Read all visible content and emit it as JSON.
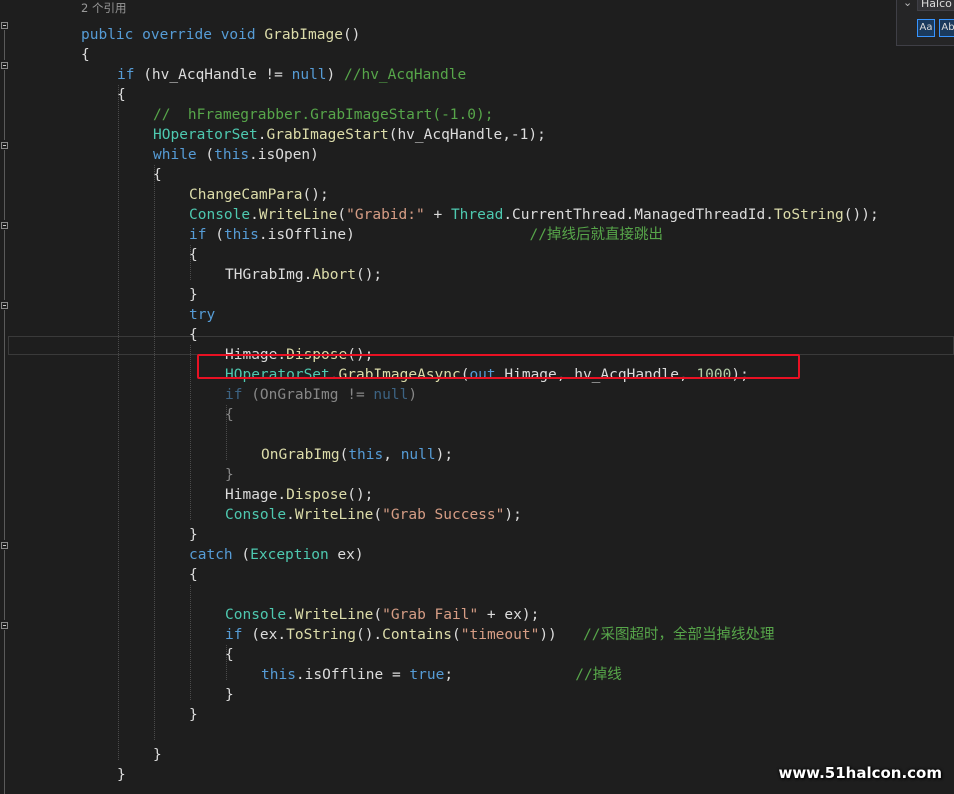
{
  "editor": {
    "colors": {
      "background": "#1e1e1e",
      "keyword": "#569cd6",
      "type": "#4ec9b0",
      "method": "#dcdcaa",
      "string": "#d69d85",
      "comment": "#57a64a",
      "number": "#b5cea8",
      "text": "#dcdcdc",
      "highlight_border": "#e81123"
    },
    "lines": [
      {
        "indent": 0,
        "kind": "codelens",
        "tokens": [
          {
            "t": "2 个引用",
            "c": "lens"
          }
        ]
      },
      {
        "indent": 0,
        "tokens": [
          {
            "t": "public",
            "c": "kw"
          },
          {
            "t": " "
          },
          {
            "t": "override",
            "c": "kw"
          },
          {
            "t": " "
          },
          {
            "t": "void",
            "c": "kw"
          },
          {
            "t": " "
          },
          {
            "t": "GrabImage",
            "c": "fn"
          },
          {
            "t": "()"
          }
        ]
      },
      {
        "indent": 0,
        "tokens": [
          {
            "t": "{"
          }
        ]
      },
      {
        "indent": 1,
        "tokens": [
          {
            "t": "if",
            "c": "kw"
          },
          {
            "t": " (hv_AcqHandle != "
          },
          {
            "t": "null",
            "c": "kw"
          },
          {
            "t": ") "
          },
          {
            "t": "//hv_AcqHandle",
            "c": "cm"
          }
        ]
      },
      {
        "indent": 1,
        "tokens": [
          {
            "t": "{"
          }
        ]
      },
      {
        "indent": 2,
        "tokens": [
          {
            "t": "//  hFramegrabber.GrabImageStart(-1.0);",
            "c": "cm"
          }
        ]
      },
      {
        "indent": 2,
        "tokens": [
          {
            "t": "HOperatorSet",
            "c": "ty"
          },
          {
            "t": "."
          },
          {
            "t": "GrabImageStart",
            "c": "fn"
          },
          {
            "t": "(hv_AcqHandle,-1);"
          }
        ]
      },
      {
        "indent": 2,
        "tokens": [
          {
            "t": "while",
            "c": "kw"
          },
          {
            "t": " ("
          },
          {
            "t": "this",
            "c": "kw"
          },
          {
            "t": ".isOpen)"
          }
        ]
      },
      {
        "indent": 2,
        "tokens": [
          {
            "t": "{"
          }
        ]
      },
      {
        "indent": 3,
        "tokens": [
          {
            "t": "ChangeCamPara",
            "c": "fn"
          },
          {
            "t": "();"
          }
        ]
      },
      {
        "indent": 3,
        "tokens": [
          {
            "t": "Console",
            "c": "ty"
          },
          {
            "t": "."
          },
          {
            "t": "WriteLine",
            "c": "fn"
          },
          {
            "t": "("
          },
          {
            "t": "\"Grabid:\"",
            "c": "str"
          },
          {
            "t": " + "
          },
          {
            "t": "Thread",
            "c": "ty"
          },
          {
            "t": ".CurrentThread.ManagedThreadId."
          },
          {
            "t": "ToString",
            "c": "fn"
          },
          {
            "t": "());"
          }
        ]
      },
      {
        "indent": 3,
        "tokens": [
          {
            "t": "if",
            "c": "kw"
          },
          {
            "t": " ("
          },
          {
            "t": "this",
            "c": "kw"
          },
          {
            "t": ".isOffline)                    "
          },
          {
            "t": "//掉线后就直接跳出",
            "c": "cm"
          }
        ]
      },
      {
        "indent": 3,
        "tokens": [
          {
            "t": "{"
          }
        ]
      },
      {
        "indent": 4,
        "tokens": [
          {
            "t": "THGrabImg."
          },
          {
            "t": "Abort",
            "c": "fn"
          },
          {
            "t": "();"
          }
        ]
      },
      {
        "indent": 3,
        "tokens": [
          {
            "t": "}"
          }
        ]
      },
      {
        "indent": 3,
        "tokens": [
          {
            "t": "try",
            "c": "kw"
          }
        ]
      },
      {
        "indent": 3,
        "tokens": [
          {
            "t": "{"
          }
        ]
      },
      {
        "indent": 4,
        "tokens": [
          {
            "t": "Himage."
          },
          {
            "t": "Dispose",
            "c": "fn"
          },
          {
            "t": "();"
          }
        ]
      },
      {
        "indent": 4,
        "tokens": [
          {
            "t": "HOperatorSet",
            "c": "ty"
          },
          {
            "t": "."
          },
          {
            "t": "GrabImageAsync",
            "c": "fn"
          },
          {
            "t": "("
          },
          {
            "t": "out",
            "c": "kw"
          },
          {
            "t": " Himage, hv_AcqHandle, "
          },
          {
            "t": "1000",
            "c": "num"
          },
          {
            "t": ");"
          }
        ]
      },
      {
        "indent": 4,
        "tokens": [
          {
            "t": "if",
            "c": "kw"
          },
          {
            "t": " (OnGrabImg != "
          },
          {
            "t": "null",
            "c": "kw"
          },
          {
            "t": ")"
          }
        ],
        "dim": true
      },
      {
        "indent": 4,
        "tokens": [
          {
            "t": "{"
          }
        ],
        "dim": true
      },
      {
        "indent": 4,
        "tokens": [
          {
            "t": ""
          }
        ]
      },
      {
        "indent": 5,
        "tokens": [
          {
            "t": "OnGrabImg",
            "c": "fn"
          },
          {
            "t": "("
          },
          {
            "t": "this",
            "c": "kw"
          },
          {
            "t": ", "
          },
          {
            "t": "null",
            "c": "kw"
          },
          {
            "t": ");"
          }
        ]
      },
      {
        "indent": 4,
        "tokens": [
          {
            "t": "}"
          }
        ],
        "dim": true
      },
      {
        "indent": 4,
        "tokens": [
          {
            "t": "Himage."
          },
          {
            "t": "Dispose",
            "c": "fn"
          },
          {
            "t": "();"
          }
        ]
      },
      {
        "indent": 4,
        "tokens": [
          {
            "t": "Console",
            "c": "ty"
          },
          {
            "t": "."
          },
          {
            "t": "WriteLine",
            "c": "fn"
          },
          {
            "t": "("
          },
          {
            "t": "\"Grab Success\"",
            "c": "str"
          },
          {
            "t": ");"
          }
        ]
      },
      {
        "indent": 3,
        "tokens": [
          {
            "t": "}"
          }
        ]
      },
      {
        "indent": 3,
        "tokens": [
          {
            "t": "catch",
            "c": "kw"
          },
          {
            "t": " ("
          },
          {
            "t": "Exception",
            "c": "ty"
          },
          {
            "t": " ex)"
          }
        ]
      },
      {
        "indent": 3,
        "tokens": [
          {
            "t": "{"
          }
        ]
      },
      {
        "indent": 4,
        "tokens": [
          {
            "t": ""
          }
        ]
      },
      {
        "indent": 4,
        "tokens": [
          {
            "t": "Console",
            "c": "ty"
          },
          {
            "t": "."
          },
          {
            "t": "WriteLine",
            "c": "fn"
          },
          {
            "t": "("
          },
          {
            "t": "\"Grab Fail\"",
            "c": "str"
          },
          {
            "t": " + ex);"
          }
        ]
      },
      {
        "indent": 4,
        "tokens": [
          {
            "t": "if",
            "c": "kw"
          },
          {
            "t": " (ex."
          },
          {
            "t": "ToString",
            "c": "fn"
          },
          {
            "t": "()."
          },
          {
            "t": "Contains",
            "c": "fn"
          },
          {
            "t": "("
          },
          {
            "t": "\"timeout\"",
            "c": "str"
          },
          {
            "t": "))   "
          },
          {
            "t": "//采图超时，全部当掉线处理",
            "c": "cm"
          }
        ]
      },
      {
        "indent": 4,
        "tokens": [
          {
            "t": "{"
          }
        ]
      },
      {
        "indent": 5,
        "tokens": [
          {
            "t": "this",
            "c": "kw"
          },
          {
            "t": ".isOffline = "
          },
          {
            "t": "true",
            "c": "kw"
          },
          {
            "t": ";              "
          },
          {
            "t": "//掉线",
            "c": "cm"
          }
        ]
      },
      {
        "indent": 4,
        "tokens": [
          {
            "t": "}"
          }
        ]
      },
      {
        "indent": 3,
        "tokens": [
          {
            "t": "}"
          }
        ]
      },
      {
        "indent": 2,
        "tokens": [
          {
            "t": ""
          }
        ]
      },
      {
        "indent": 2,
        "tokens": [
          {
            "t": "}"
          }
        ]
      },
      {
        "indent": 1,
        "tokens": [
          {
            "t": "}"
          }
        ]
      }
    ]
  },
  "find_widget": {
    "search_text": "Halco",
    "match_case_label": "Aa",
    "whole_word_label": "Ab"
  },
  "watermark": "www.51halcon.com"
}
